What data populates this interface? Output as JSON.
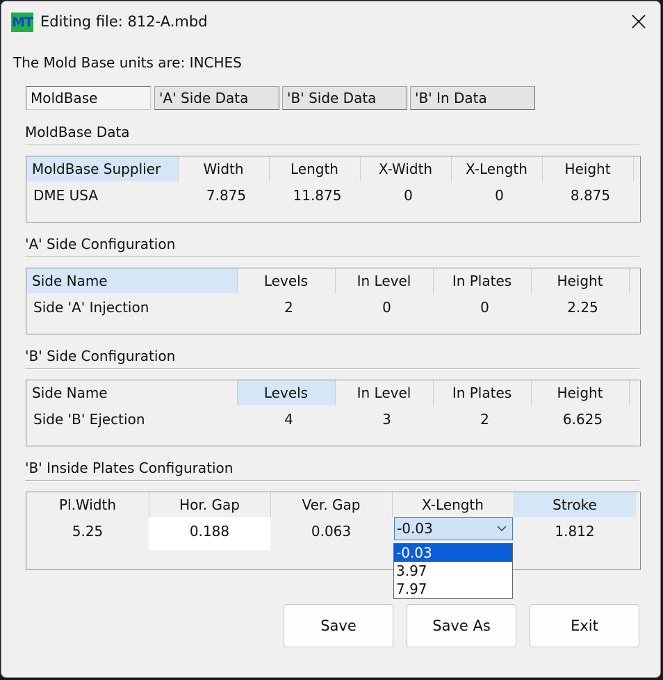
{
  "window": {
    "app_icon_text": "MT",
    "title": "Editing file: 812-A.mbd"
  },
  "units_text": "The Mold Base units are: INCHES",
  "tabs": [
    "MoldBase",
    "'A' Side Data",
    "'B' Side Data",
    "'B' In Data"
  ],
  "moldbase": {
    "title": "MoldBase Data",
    "headers": [
      "MoldBase Supplier",
      "Width",
      "Length",
      "X-Width",
      "X-Length",
      "Height"
    ],
    "row": [
      "DME USA",
      "7.875",
      "11.875",
      "0",
      "0",
      "8.875"
    ]
  },
  "a_side": {
    "title": "'A' Side Configuration",
    "headers": [
      "Side Name",
      "Levels",
      "In Level",
      "In Plates",
      "Height"
    ],
    "row": [
      "Side 'A' Injection",
      "2",
      "0",
      "0",
      "2.25"
    ]
  },
  "b_side": {
    "title": "'B' Side Configuration",
    "headers": [
      "Side Name",
      "Levels",
      "In Level",
      "In Plates",
      "Height"
    ],
    "row": [
      "Side 'B' Ejection",
      "4",
      "3",
      "2",
      "6.625"
    ]
  },
  "b_inside": {
    "title": "'B' Inside Plates Configuration",
    "headers": [
      "Pl.Width",
      "Hor. Gap",
      "Ver. Gap",
      "X-Length",
      "Stroke"
    ],
    "row": [
      "5.25",
      "0.188",
      "0.063",
      "-0.03",
      "1.812"
    ],
    "xlength_options": [
      "-0.03",
      "3.97",
      "7.97"
    ]
  },
  "buttons": {
    "save": "Save",
    "save_as": "Save As",
    "exit": "Exit"
  },
  "colors": {
    "selected_cell": "#d5e6f6",
    "dropdown_highlight": "#0a5fd8",
    "icon_bg": "#1fb04a",
    "icon_text": "#1a3fd8"
  },
  "icons": {
    "close": "close-icon",
    "combo": "chevron-down-icon"
  }
}
